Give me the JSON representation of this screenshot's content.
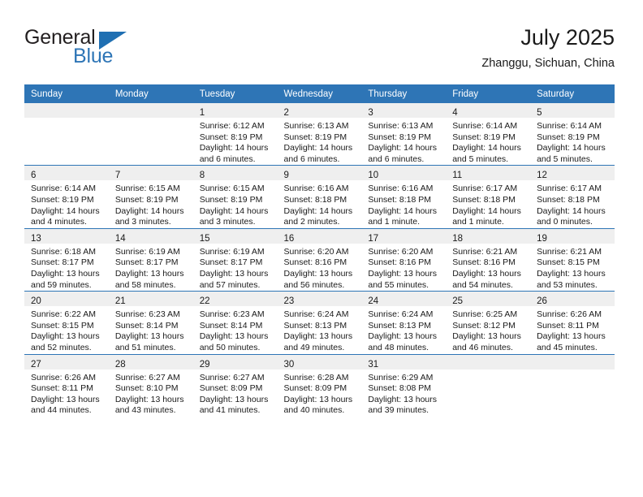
{
  "brand": {
    "name_primary": "General",
    "name_secondary": "Blue",
    "accent_color": "#2e75b6"
  },
  "header": {
    "title": "July 2025",
    "location": "Zhanggu, Sichuan, China"
  },
  "calendar": {
    "weekday_headers": [
      "Sunday",
      "Monday",
      "Tuesday",
      "Wednesday",
      "Thursday",
      "Friday",
      "Saturday"
    ],
    "weeks": [
      [
        {
          "day": "",
          "lines": []
        },
        {
          "day": "",
          "lines": []
        },
        {
          "day": "1",
          "lines": [
            "Sunrise: 6:12 AM",
            "Sunset: 8:19 PM",
            "Daylight: 14 hours",
            "and 6 minutes."
          ]
        },
        {
          "day": "2",
          "lines": [
            "Sunrise: 6:13 AM",
            "Sunset: 8:19 PM",
            "Daylight: 14 hours",
            "and 6 minutes."
          ]
        },
        {
          "day": "3",
          "lines": [
            "Sunrise: 6:13 AM",
            "Sunset: 8:19 PM",
            "Daylight: 14 hours",
            "and 6 minutes."
          ]
        },
        {
          "day": "4",
          "lines": [
            "Sunrise: 6:14 AM",
            "Sunset: 8:19 PM",
            "Daylight: 14 hours",
            "and 5 minutes."
          ]
        },
        {
          "day": "5",
          "lines": [
            "Sunrise: 6:14 AM",
            "Sunset: 8:19 PM",
            "Daylight: 14 hours",
            "and 5 minutes."
          ]
        }
      ],
      [
        {
          "day": "6",
          "lines": [
            "Sunrise: 6:14 AM",
            "Sunset: 8:19 PM",
            "Daylight: 14 hours",
            "and 4 minutes."
          ]
        },
        {
          "day": "7",
          "lines": [
            "Sunrise: 6:15 AM",
            "Sunset: 8:19 PM",
            "Daylight: 14 hours",
            "and 3 minutes."
          ]
        },
        {
          "day": "8",
          "lines": [
            "Sunrise: 6:15 AM",
            "Sunset: 8:19 PM",
            "Daylight: 14 hours",
            "and 3 minutes."
          ]
        },
        {
          "day": "9",
          "lines": [
            "Sunrise: 6:16 AM",
            "Sunset: 8:18 PM",
            "Daylight: 14 hours",
            "and 2 minutes."
          ]
        },
        {
          "day": "10",
          "lines": [
            "Sunrise: 6:16 AM",
            "Sunset: 8:18 PM",
            "Daylight: 14 hours",
            "and 1 minute."
          ]
        },
        {
          "day": "11",
          "lines": [
            "Sunrise: 6:17 AM",
            "Sunset: 8:18 PM",
            "Daylight: 14 hours",
            "and 1 minute."
          ]
        },
        {
          "day": "12",
          "lines": [
            "Sunrise: 6:17 AM",
            "Sunset: 8:18 PM",
            "Daylight: 14 hours",
            "and 0 minutes."
          ]
        }
      ],
      [
        {
          "day": "13",
          "lines": [
            "Sunrise: 6:18 AM",
            "Sunset: 8:17 PM",
            "Daylight: 13 hours",
            "and 59 minutes."
          ]
        },
        {
          "day": "14",
          "lines": [
            "Sunrise: 6:19 AM",
            "Sunset: 8:17 PM",
            "Daylight: 13 hours",
            "and 58 minutes."
          ]
        },
        {
          "day": "15",
          "lines": [
            "Sunrise: 6:19 AM",
            "Sunset: 8:17 PM",
            "Daylight: 13 hours",
            "and 57 minutes."
          ]
        },
        {
          "day": "16",
          "lines": [
            "Sunrise: 6:20 AM",
            "Sunset: 8:16 PM",
            "Daylight: 13 hours",
            "and 56 minutes."
          ]
        },
        {
          "day": "17",
          "lines": [
            "Sunrise: 6:20 AM",
            "Sunset: 8:16 PM",
            "Daylight: 13 hours",
            "and 55 minutes."
          ]
        },
        {
          "day": "18",
          "lines": [
            "Sunrise: 6:21 AM",
            "Sunset: 8:16 PM",
            "Daylight: 13 hours",
            "and 54 minutes."
          ]
        },
        {
          "day": "19",
          "lines": [
            "Sunrise: 6:21 AM",
            "Sunset: 8:15 PM",
            "Daylight: 13 hours",
            "and 53 minutes."
          ]
        }
      ],
      [
        {
          "day": "20",
          "lines": [
            "Sunrise: 6:22 AM",
            "Sunset: 8:15 PM",
            "Daylight: 13 hours",
            "and 52 minutes."
          ]
        },
        {
          "day": "21",
          "lines": [
            "Sunrise: 6:23 AM",
            "Sunset: 8:14 PM",
            "Daylight: 13 hours",
            "and 51 minutes."
          ]
        },
        {
          "day": "22",
          "lines": [
            "Sunrise: 6:23 AM",
            "Sunset: 8:14 PM",
            "Daylight: 13 hours",
            "and 50 minutes."
          ]
        },
        {
          "day": "23",
          "lines": [
            "Sunrise: 6:24 AM",
            "Sunset: 8:13 PM",
            "Daylight: 13 hours",
            "and 49 minutes."
          ]
        },
        {
          "day": "24",
          "lines": [
            "Sunrise: 6:24 AM",
            "Sunset: 8:13 PM",
            "Daylight: 13 hours",
            "and 48 minutes."
          ]
        },
        {
          "day": "25",
          "lines": [
            "Sunrise: 6:25 AM",
            "Sunset: 8:12 PM",
            "Daylight: 13 hours",
            "and 46 minutes."
          ]
        },
        {
          "day": "26",
          "lines": [
            "Sunrise: 6:26 AM",
            "Sunset: 8:11 PM",
            "Daylight: 13 hours",
            "and 45 minutes."
          ]
        }
      ],
      [
        {
          "day": "27",
          "lines": [
            "Sunrise: 6:26 AM",
            "Sunset: 8:11 PM",
            "Daylight: 13 hours",
            "and 44 minutes."
          ]
        },
        {
          "day": "28",
          "lines": [
            "Sunrise: 6:27 AM",
            "Sunset: 8:10 PM",
            "Daylight: 13 hours",
            "and 43 minutes."
          ]
        },
        {
          "day": "29",
          "lines": [
            "Sunrise: 6:27 AM",
            "Sunset: 8:09 PM",
            "Daylight: 13 hours",
            "and 41 minutes."
          ]
        },
        {
          "day": "30",
          "lines": [
            "Sunrise: 6:28 AM",
            "Sunset: 8:09 PM",
            "Daylight: 13 hours",
            "and 40 minutes."
          ]
        },
        {
          "day": "31",
          "lines": [
            "Sunrise: 6:29 AM",
            "Sunset: 8:08 PM",
            "Daylight: 13 hours",
            "and 39 minutes."
          ]
        },
        {
          "day": "",
          "lines": []
        },
        {
          "day": "",
          "lines": []
        }
      ]
    ]
  }
}
